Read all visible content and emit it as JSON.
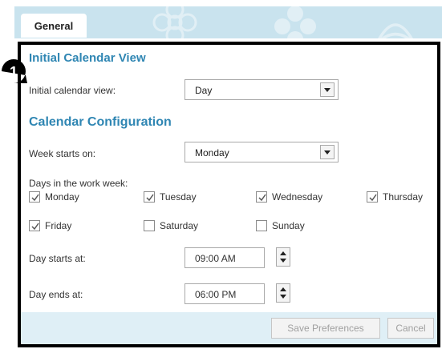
{
  "tab": {
    "label": "General"
  },
  "callout": {
    "number": "1"
  },
  "initial_view": {
    "title": "Initial Calendar View",
    "label": "Initial calendar view:",
    "value": "Day"
  },
  "config": {
    "title": "Calendar Configuration",
    "week_start_label": "Week starts on:",
    "week_start_value": "Monday",
    "work_week_label": "Days in the work week:",
    "days": [
      {
        "label": "Monday",
        "checked": true
      },
      {
        "label": "Tuesday",
        "checked": true
      },
      {
        "label": "Wednesday",
        "checked": true
      },
      {
        "label": "Thursday",
        "checked": true
      },
      {
        "label": "Friday",
        "checked": true
      },
      {
        "label": "Saturday",
        "checked": false
      },
      {
        "label": "Sunday",
        "checked": false
      }
    ],
    "day_start_label": "Day starts at:",
    "day_start_value": "09:00 AM",
    "day_end_label": "Day ends at:",
    "day_end_value": "06:00 PM"
  },
  "footer": {
    "save_label": "Save Preferences",
    "cancel_label": "Cancel"
  },
  "colors": {
    "section_title": "#2f86b3",
    "header_band": "#c9e3ee",
    "footer_band": "#dfeff6"
  }
}
